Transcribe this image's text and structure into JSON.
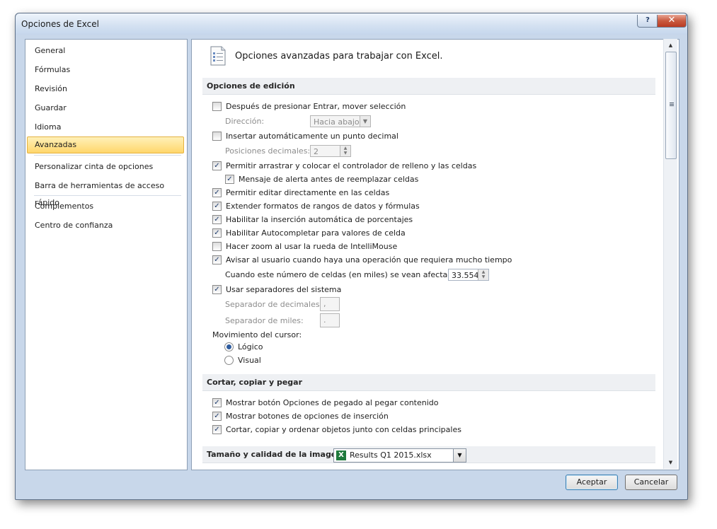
{
  "window": {
    "title": "Opciones de Excel",
    "help_glyph": "?",
    "close_glyph": "✕"
  },
  "nav": {
    "items": [
      {
        "label": "General"
      },
      {
        "label": "Fórmulas"
      },
      {
        "label": "Revisión"
      },
      {
        "label": "Guardar"
      },
      {
        "label": "Idioma"
      },
      {
        "label": "Avanzadas"
      },
      {
        "label": "Personalizar cinta de opciones"
      },
      {
        "label": "Barra de herramientas de acceso rápido"
      },
      {
        "label": "Complementos"
      },
      {
        "label": "Centro de confianza"
      }
    ],
    "selected": "Avanzadas"
  },
  "header": {
    "title": "Opciones avanzadas para trabajar con Excel.",
    "icon": "settings-page-icon"
  },
  "editing": {
    "section_title": "Opciones de edición",
    "after_enter": "Después de presionar Entrar, mover selección",
    "direction_label": "Dirección:",
    "direction_value": "Hacia abajo",
    "auto_decimal": "Insertar automáticamente un punto decimal",
    "decimal_places_label": "Posiciones decimales:",
    "decimal_places_value": "2",
    "fill_handle": "Permitir arrastrar y colocar el controlador de relleno y las celdas",
    "alert_overwrite": "Mensaje de alerta antes de reemplazar celdas",
    "edit_in_cells": "Permitir editar directamente en las celdas",
    "extend_formats": "Extender formatos de rangos de datos y fórmulas",
    "auto_percent": "Habilitar la inserción automática de porcentajes",
    "autocomplete": "Habilitar Autocompletar para valores de celda",
    "zoom_intellimouse": "Hacer zoom al usar la rueda de IntelliMouse",
    "alert_slow": "Avisar al usuario cuando haya una operación que requiera mucho tiempo",
    "cells_affected_label": "Cuando este número de celdas (en miles) se vean afectadas:",
    "cells_affected_value": "33.554",
    "system_separators": "Usar separadores del sistema",
    "decimal_sep_label": "Separador de decimales:",
    "decimal_sep_value": ",",
    "thousands_sep_label": "Separador de miles:",
    "thousands_sep_value": ".",
    "cursor_movement_label": "Movimiento del cursor:",
    "cursor_logical": "Lógico",
    "cursor_visual": "Visual"
  },
  "cut_copy": {
    "section_title": "Cortar, copiar y pegar",
    "paste_options": "Mostrar botón Opciones de pegado al pegar contenido",
    "insert_options": "Mostrar botones de opciones de inserción",
    "cut_sort_objects": "Cortar, copiar y ordenar objetos junto con celdas principales"
  },
  "image_quality": {
    "section_title": "Tamaño y calidad de la imagen",
    "file_value": "Results Q1 2015.xlsx"
  },
  "footer": {
    "ok_label": "Aceptar",
    "cancel_label": "Cancelar"
  },
  "colors": {
    "selected_nav": "#ffd66b",
    "check": "#1e3c6e",
    "section_bg": "#eef0f3"
  }
}
